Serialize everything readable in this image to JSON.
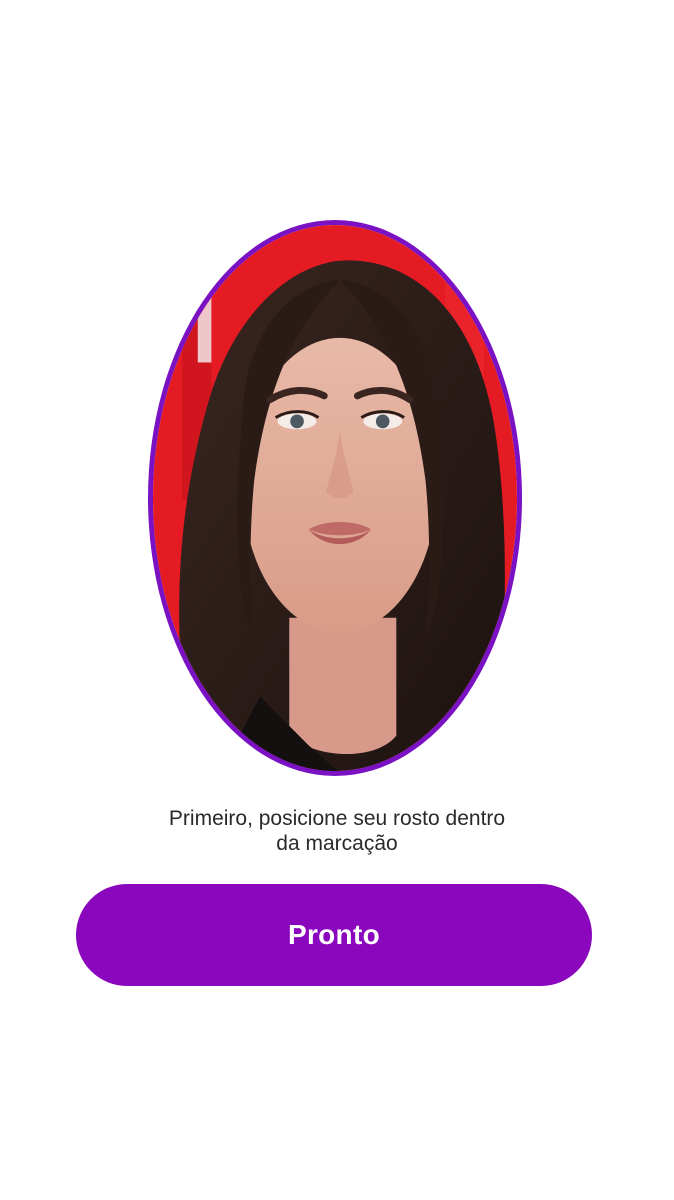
{
  "screen": {
    "background_color": "#ffffff"
  },
  "face_capture": {
    "frame_color": "#7a12c4",
    "photo_description_icon": "face-photo"
  },
  "instruction": {
    "line1": "Primeiro, posicione seu rosto dentro",
    "line2": "da marcação"
  },
  "action": {
    "button_label": "Pronto",
    "button_color": "#8a07bd"
  }
}
